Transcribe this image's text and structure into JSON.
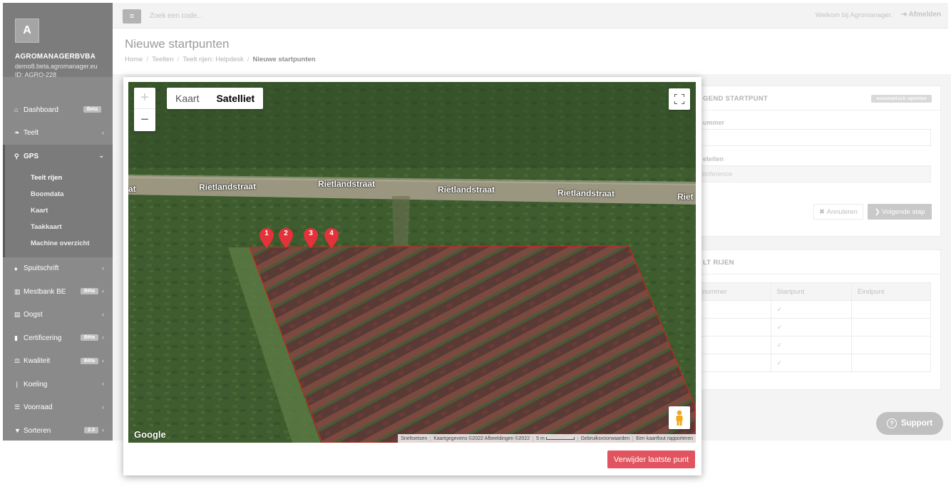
{
  "sidebar": {
    "avatar_letter": "A",
    "company": "AGROMANAGERBVBA",
    "domain": "demo8.beta.agromanager.eu",
    "id": "ID: AGRO-228",
    "items": [
      {
        "label": "Dashboard",
        "icon": "home-icon",
        "badge": "Beta"
      },
      {
        "label": "Teelt",
        "icon": "leaf-icon"
      },
      {
        "label": "GPS",
        "icon": "map-pin-icon"
      },
      {
        "label": "Spuitschrift",
        "icon": "drop-icon"
      },
      {
        "label": "Mestbank BE",
        "icon": "bank-icon",
        "badge": "Bèta"
      },
      {
        "label": "Oogst",
        "icon": "basket-icon"
      },
      {
        "label": "Certificering",
        "icon": "book-icon",
        "badge": "Bèta"
      },
      {
        "label": "Kwaliteit",
        "icon": "scale-icon",
        "badge": "Bèta"
      },
      {
        "label": "Koeling",
        "icon": "thermometer-icon"
      },
      {
        "label": "Voorraad",
        "icon": "list-icon"
      },
      {
        "label": "Sorteren",
        "icon": "filter-icon",
        "badge": "2.0"
      }
    ],
    "gps_sub": [
      "Teelt rijen",
      "Boomdata",
      "Kaart",
      "Taakkaart",
      "Machine overzicht"
    ]
  },
  "topbar": {
    "search_placeholder": "Zoek een code...",
    "welcome": "Welkom bij Agromanager.",
    "logout": "Afmelden"
  },
  "page": {
    "title": "Nieuwe startpunten",
    "breadcrumb": [
      "Home",
      "Teelten",
      "Teelt rijen: Helpdesk",
      "Nieuwe startpunten"
    ]
  },
  "panel1": {
    "title": "GEND STARTPUNT",
    "auto_btn": "automatisch oplellen",
    "label1": "ummer",
    "label2": "eteiten",
    "value2": "onference",
    "cancel": "Annuleren",
    "next": "Volgende stap"
  },
  "panel2": {
    "title": "LT RIJEN",
    "columns": [
      "nummer",
      "Startpunt",
      "Eindpunt"
    ],
    "rows": [
      [
        "",
        "✓",
        ""
      ],
      [
        "",
        "✓",
        ""
      ],
      [
        "",
        "✓",
        ""
      ],
      [
        "",
        "✓",
        ""
      ]
    ]
  },
  "support": "Support",
  "modal": {
    "map_types": [
      "Kaart",
      "Satelliet"
    ],
    "selected_map_type": "Satelliet",
    "streets": [
      "at",
      "Rietlandstraat",
      "Rietlandstraat",
      "Rietlandstraat",
      "Rietlandstraat",
      "Riet"
    ],
    "markers": [
      "1",
      "2",
      "3",
      "4"
    ],
    "google": "Google",
    "attribution": [
      "Sneltoetsen",
      "Kaartgegevens ©2022 Afbeeldingen ©2022",
      "5 m",
      "Gebruiksvoorwaarden",
      "Een kaartfout rapporteren"
    ],
    "delete_button": "Verwijder laatste punt"
  }
}
